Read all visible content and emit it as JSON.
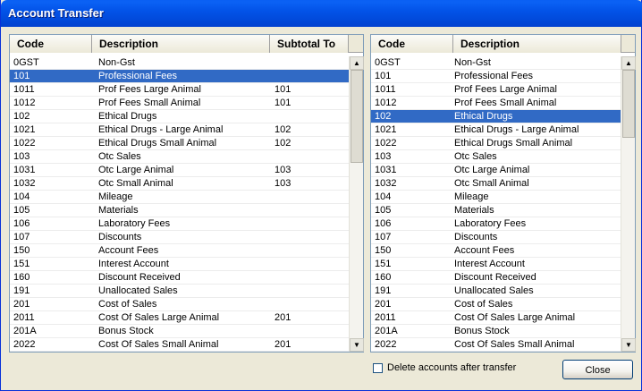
{
  "window": {
    "title": "Account Transfer"
  },
  "left_list": {
    "columns": {
      "code": "Code",
      "description": "Description",
      "subtotal": "Subtotal To"
    },
    "selected_index": 1,
    "rows": [
      {
        "code": "0GST",
        "description": "Non-Gst",
        "subtotal": ""
      },
      {
        "code": "101",
        "description": "Professional Fees",
        "subtotal": ""
      },
      {
        "code": "1011",
        "description": "Prof Fees Large Animal",
        "subtotal": "101"
      },
      {
        "code": "1012",
        "description": "Prof Fees Small Animal",
        "subtotal": "101"
      },
      {
        "code": "102",
        "description": "Ethical Drugs",
        "subtotal": ""
      },
      {
        "code": "1021",
        "description": "Ethical Drugs - Large Animal",
        "subtotal": "102"
      },
      {
        "code": "1022",
        "description": "Ethical Drugs Small Animal",
        "subtotal": "102"
      },
      {
        "code": "103",
        "description": "Otc Sales",
        "subtotal": ""
      },
      {
        "code": "1031",
        "description": "Otc Large Animal",
        "subtotal": "103"
      },
      {
        "code": "1032",
        "description": "Otc Small Animal",
        "subtotal": "103"
      },
      {
        "code": "104",
        "description": "Mileage",
        "subtotal": ""
      },
      {
        "code": "105",
        "description": "Materials",
        "subtotal": ""
      },
      {
        "code": "106",
        "description": "Laboratory Fees",
        "subtotal": ""
      },
      {
        "code": "107",
        "description": "Discounts",
        "subtotal": ""
      },
      {
        "code": "150",
        "description": "Account Fees",
        "subtotal": ""
      },
      {
        "code": "151",
        "description": "Interest Account",
        "subtotal": ""
      },
      {
        "code": "160",
        "description": "Discount Received",
        "subtotal": ""
      },
      {
        "code": "191",
        "description": "Unallocated Sales",
        "subtotal": ""
      },
      {
        "code": "201",
        "description": "Cost of Sales",
        "subtotal": ""
      },
      {
        "code": "2011",
        "description": "Cost Of Sales Large Animal",
        "subtotal": "201"
      },
      {
        "code": "201A",
        "description": "Bonus Stock",
        "subtotal": ""
      },
      {
        "code": "2022",
        "description": "Cost Of Sales Small Animal",
        "subtotal": "201"
      }
    ]
  },
  "right_list": {
    "columns": {
      "code": "Code",
      "description": "Description"
    },
    "selected_index": 4,
    "rows": [
      {
        "code": "0GST",
        "description": "Non-Gst"
      },
      {
        "code": "101",
        "description": "Professional Fees"
      },
      {
        "code": "1011",
        "description": "Prof Fees Large Animal"
      },
      {
        "code": "1012",
        "description": "Prof Fees Small Animal"
      },
      {
        "code": "102",
        "description": "Ethical Drugs"
      },
      {
        "code": "1021",
        "description": "Ethical Drugs - Large Animal"
      },
      {
        "code": "1022",
        "description": "Ethical Drugs Small Animal"
      },
      {
        "code": "103",
        "description": "Otc Sales"
      },
      {
        "code": "1031",
        "description": "Otc Large Animal"
      },
      {
        "code": "1032",
        "description": "Otc Small Animal"
      },
      {
        "code": "104",
        "description": "Mileage"
      },
      {
        "code": "105",
        "description": "Materials"
      },
      {
        "code": "106",
        "description": "Laboratory Fees"
      },
      {
        "code": "107",
        "description": "Discounts"
      },
      {
        "code": "150",
        "description": "Account Fees"
      },
      {
        "code": "151",
        "description": "Interest Account"
      },
      {
        "code": "160",
        "description": "Discount Received"
      },
      {
        "code": "191",
        "description": "Unallocated Sales"
      },
      {
        "code": "201",
        "description": "Cost of Sales"
      },
      {
        "code": "2011",
        "description": "Cost Of Sales Large Animal"
      },
      {
        "code": "201A",
        "description": "Bonus Stock"
      },
      {
        "code": "2022",
        "description": "Cost Of Sales Small Animal"
      }
    ]
  },
  "options": {
    "delete_after_transfer_label": "Delete accounts after transfer",
    "delete_after_transfer_checked": false
  },
  "buttons": {
    "close_label": "Close"
  },
  "icons": {
    "scroll_up": "triangle-up-icon",
    "scroll_down": "triangle-down-icon"
  }
}
